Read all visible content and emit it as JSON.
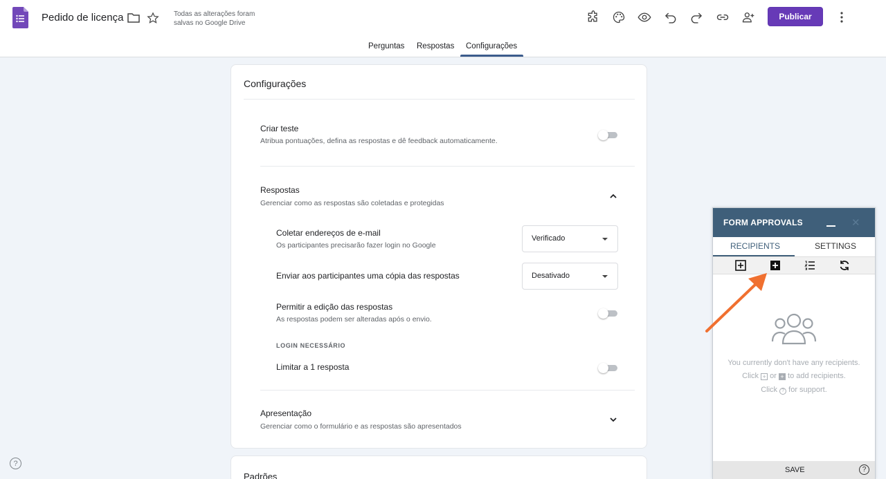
{
  "header": {
    "doc_title": "Pedido de licença",
    "saved_note": "Todas as alterações foram salvas no Google Drive",
    "publish_label": "Publicar"
  },
  "tabs": [
    {
      "label": "Perguntas"
    },
    {
      "label": "Respostas"
    },
    {
      "label": "Configurações"
    }
  ],
  "settings": {
    "title": "Configurações",
    "quiz": {
      "title": "Criar teste",
      "subtitle": "Atribua pontuações, defina as respostas e dê feedback automaticamente.",
      "enabled": false
    },
    "responses": {
      "title": "Respostas",
      "subtitle": "Gerenciar como as respostas são coletadas e protegidas",
      "collect_email": {
        "title": "Coletar endereços de e-mail",
        "subtitle": "Os participantes precisarão fazer login no Google",
        "value": "Verificado"
      },
      "send_copy": {
        "title": "Enviar aos participantes uma cópia das respostas",
        "value": "Desativado"
      },
      "allow_edit": {
        "title": "Permitir a edição das respostas",
        "subtitle": "As respostas podem ser alteradas após o envio.",
        "enabled": false
      },
      "login_required_label": "LOGIN NECESSÁRIO",
      "limit_one": {
        "title": "Limitar a 1 resposta",
        "enabled": false
      }
    },
    "presentation": {
      "title": "Apresentação",
      "subtitle": "Gerenciar como o formulário e as respostas são apresentados"
    },
    "next_card_peek": "Padrões"
  },
  "form_approvals": {
    "title": "FORM APPROVALS",
    "tabs": [
      "RECIPIENTS",
      "SETTINGS"
    ],
    "empty_line1": "You currently don't have any recipients.",
    "empty_click": "Click",
    "empty_or": "or",
    "empty_add": "to add recipients.",
    "empty_support_click": "Click",
    "empty_support": "for support.",
    "save_label": "SAVE"
  },
  "colors": {
    "accent_purple": "#673ab7",
    "panel_header": "#3f5f7a",
    "arrow": "#f07030"
  }
}
